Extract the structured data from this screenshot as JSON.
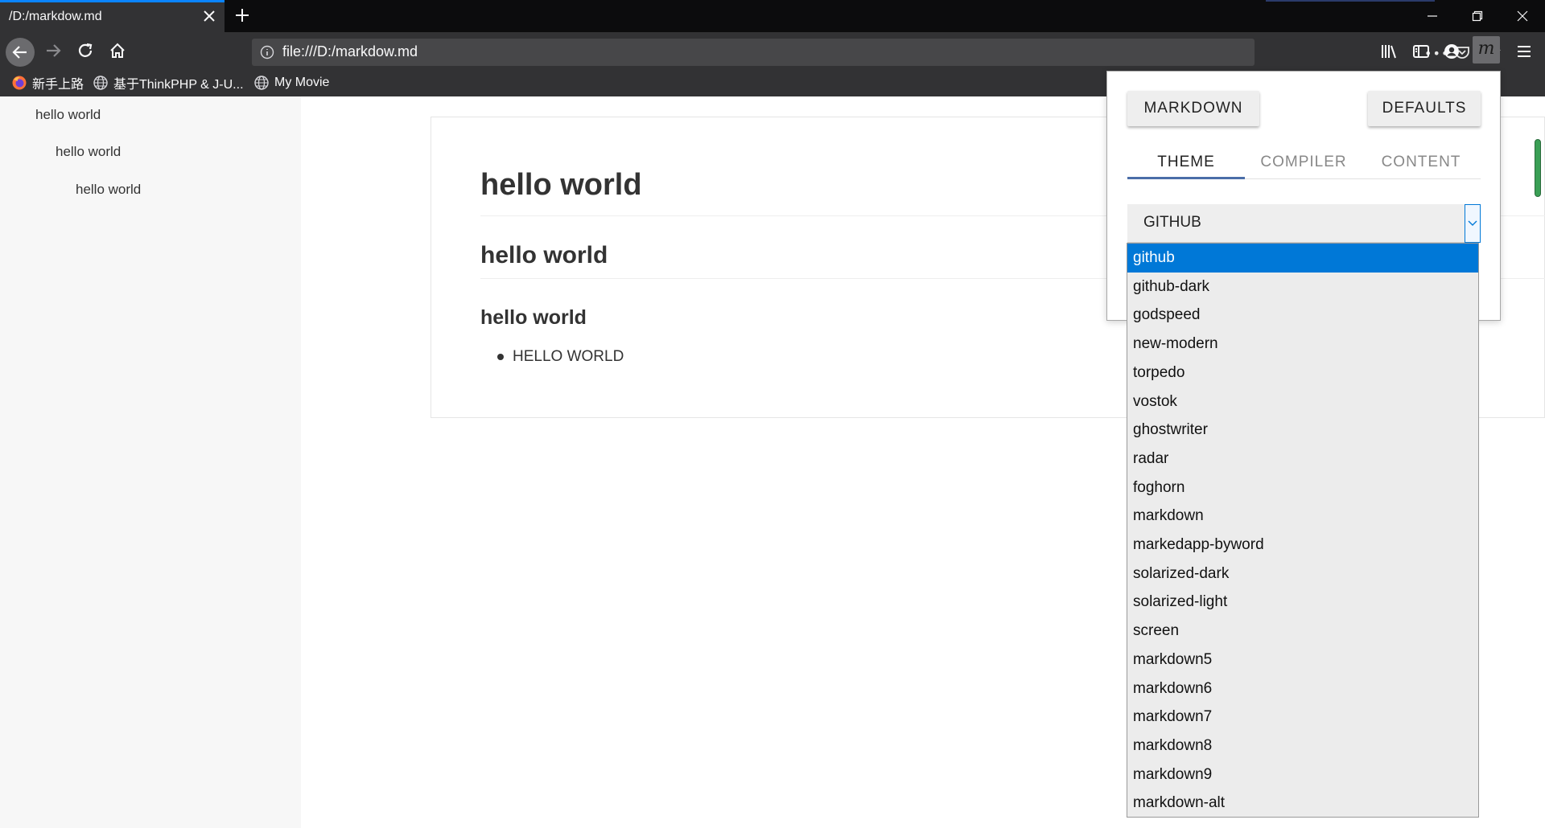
{
  "tab": {
    "title": "/D:/markdow.md"
  },
  "url": {
    "text": "file:///D:/markdow.md",
    "page_actions": "•••"
  },
  "bookmarks": [
    {
      "label": "新手上路",
      "icon": "firefox-icon"
    },
    {
      "label": "基于ThinkPHP & J-U...",
      "icon": "globe-icon"
    },
    {
      "label": "My Movie",
      "icon": "globe-icon"
    }
  ],
  "extension": {
    "label": "m"
  },
  "toc": [
    "hello world",
    "hello world",
    "hello world"
  ],
  "doc": {
    "h1": "hello world",
    "h2": "hello world",
    "h3": "hello world",
    "list_item": "HELLO WORLD"
  },
  "popup": {
    "markdown_button": "MARKDOWN",
    "defaults_button": "DEFAULTS",
    "tabs": [
      "THEME",
      "COMPILER",
      "CONTENT"
    ],
    "active_tab": "THEME",
    "select_value": "GITHUB"
  },
  "dropdown": {
    "selected": "github",
    "options": [
      "github",
      "github-dark",
      "godspeed",
      "new-modern",
      "torpedo",
      "vostok",
      "ghostwriter",
      "radar",
      "foghorn",
      "markdown",
      "markedapp-byword",
      "solarized-dark",
      "solarized-light",
      "screen",
      "markdown5",
      "markdown6",
      "markdown7",
      "markdown8",
      "markdown9",
      "markdown-alt"
    ]
  },
  "colors": {
    "accent": "#0a84ff",
    "selection": "#0078d7",
    "chrome_dark": "#0c0c0d",
    "toolbar": "#323234"
  }
}
